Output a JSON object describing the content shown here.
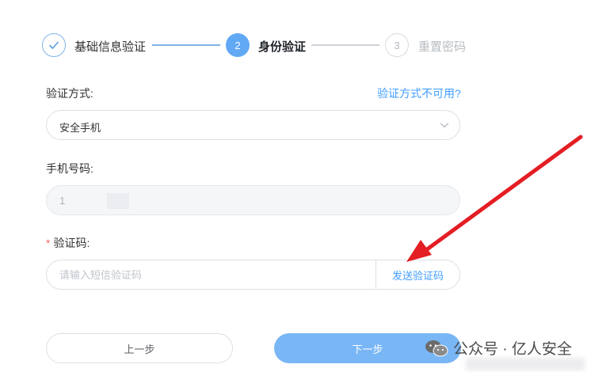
{
  "steps": [
    {
      "number": "✓",
      "label": "基础信息验证",
      "state": "done"
    },
    {
      "number": "2",
      "label": "身份验证",
      "state": "active"
    },
    {
      "number": "3",
      "label": "重置密码",
      "state": "todo"
    }
  ],
  "form": {
    "method_label": "验证方式:",
    "method_unavailable_link": "验证方式不可用?",
    "method_value": "安全手机",
    "phone_label": "手机号码:",
    "phone_value": "1",
    "code_required_mark": "*",
    "code_label": "验证码:",
    "code_placeholder": "请输入短信验证码",
    "send_code_button": "发送验证码"
  },
  "buttons": {
    "prev": "上一步",
    "next": "下一步"
  },
  "watermark": {
    "text": "公众号 · 亿人安全"
  },
  "colors": {
    "accent": "#409eff",
    "step_active": "#61a8f5",
    "next_button": "#79b6f5",
    "annotation_arrow": "#e31e24"
  },
  "icons": {
    "select_chevron": "chevron-down-icon",
    "step_done": "check-icon",
    "watermark": "wechat-icon"
  }
}
